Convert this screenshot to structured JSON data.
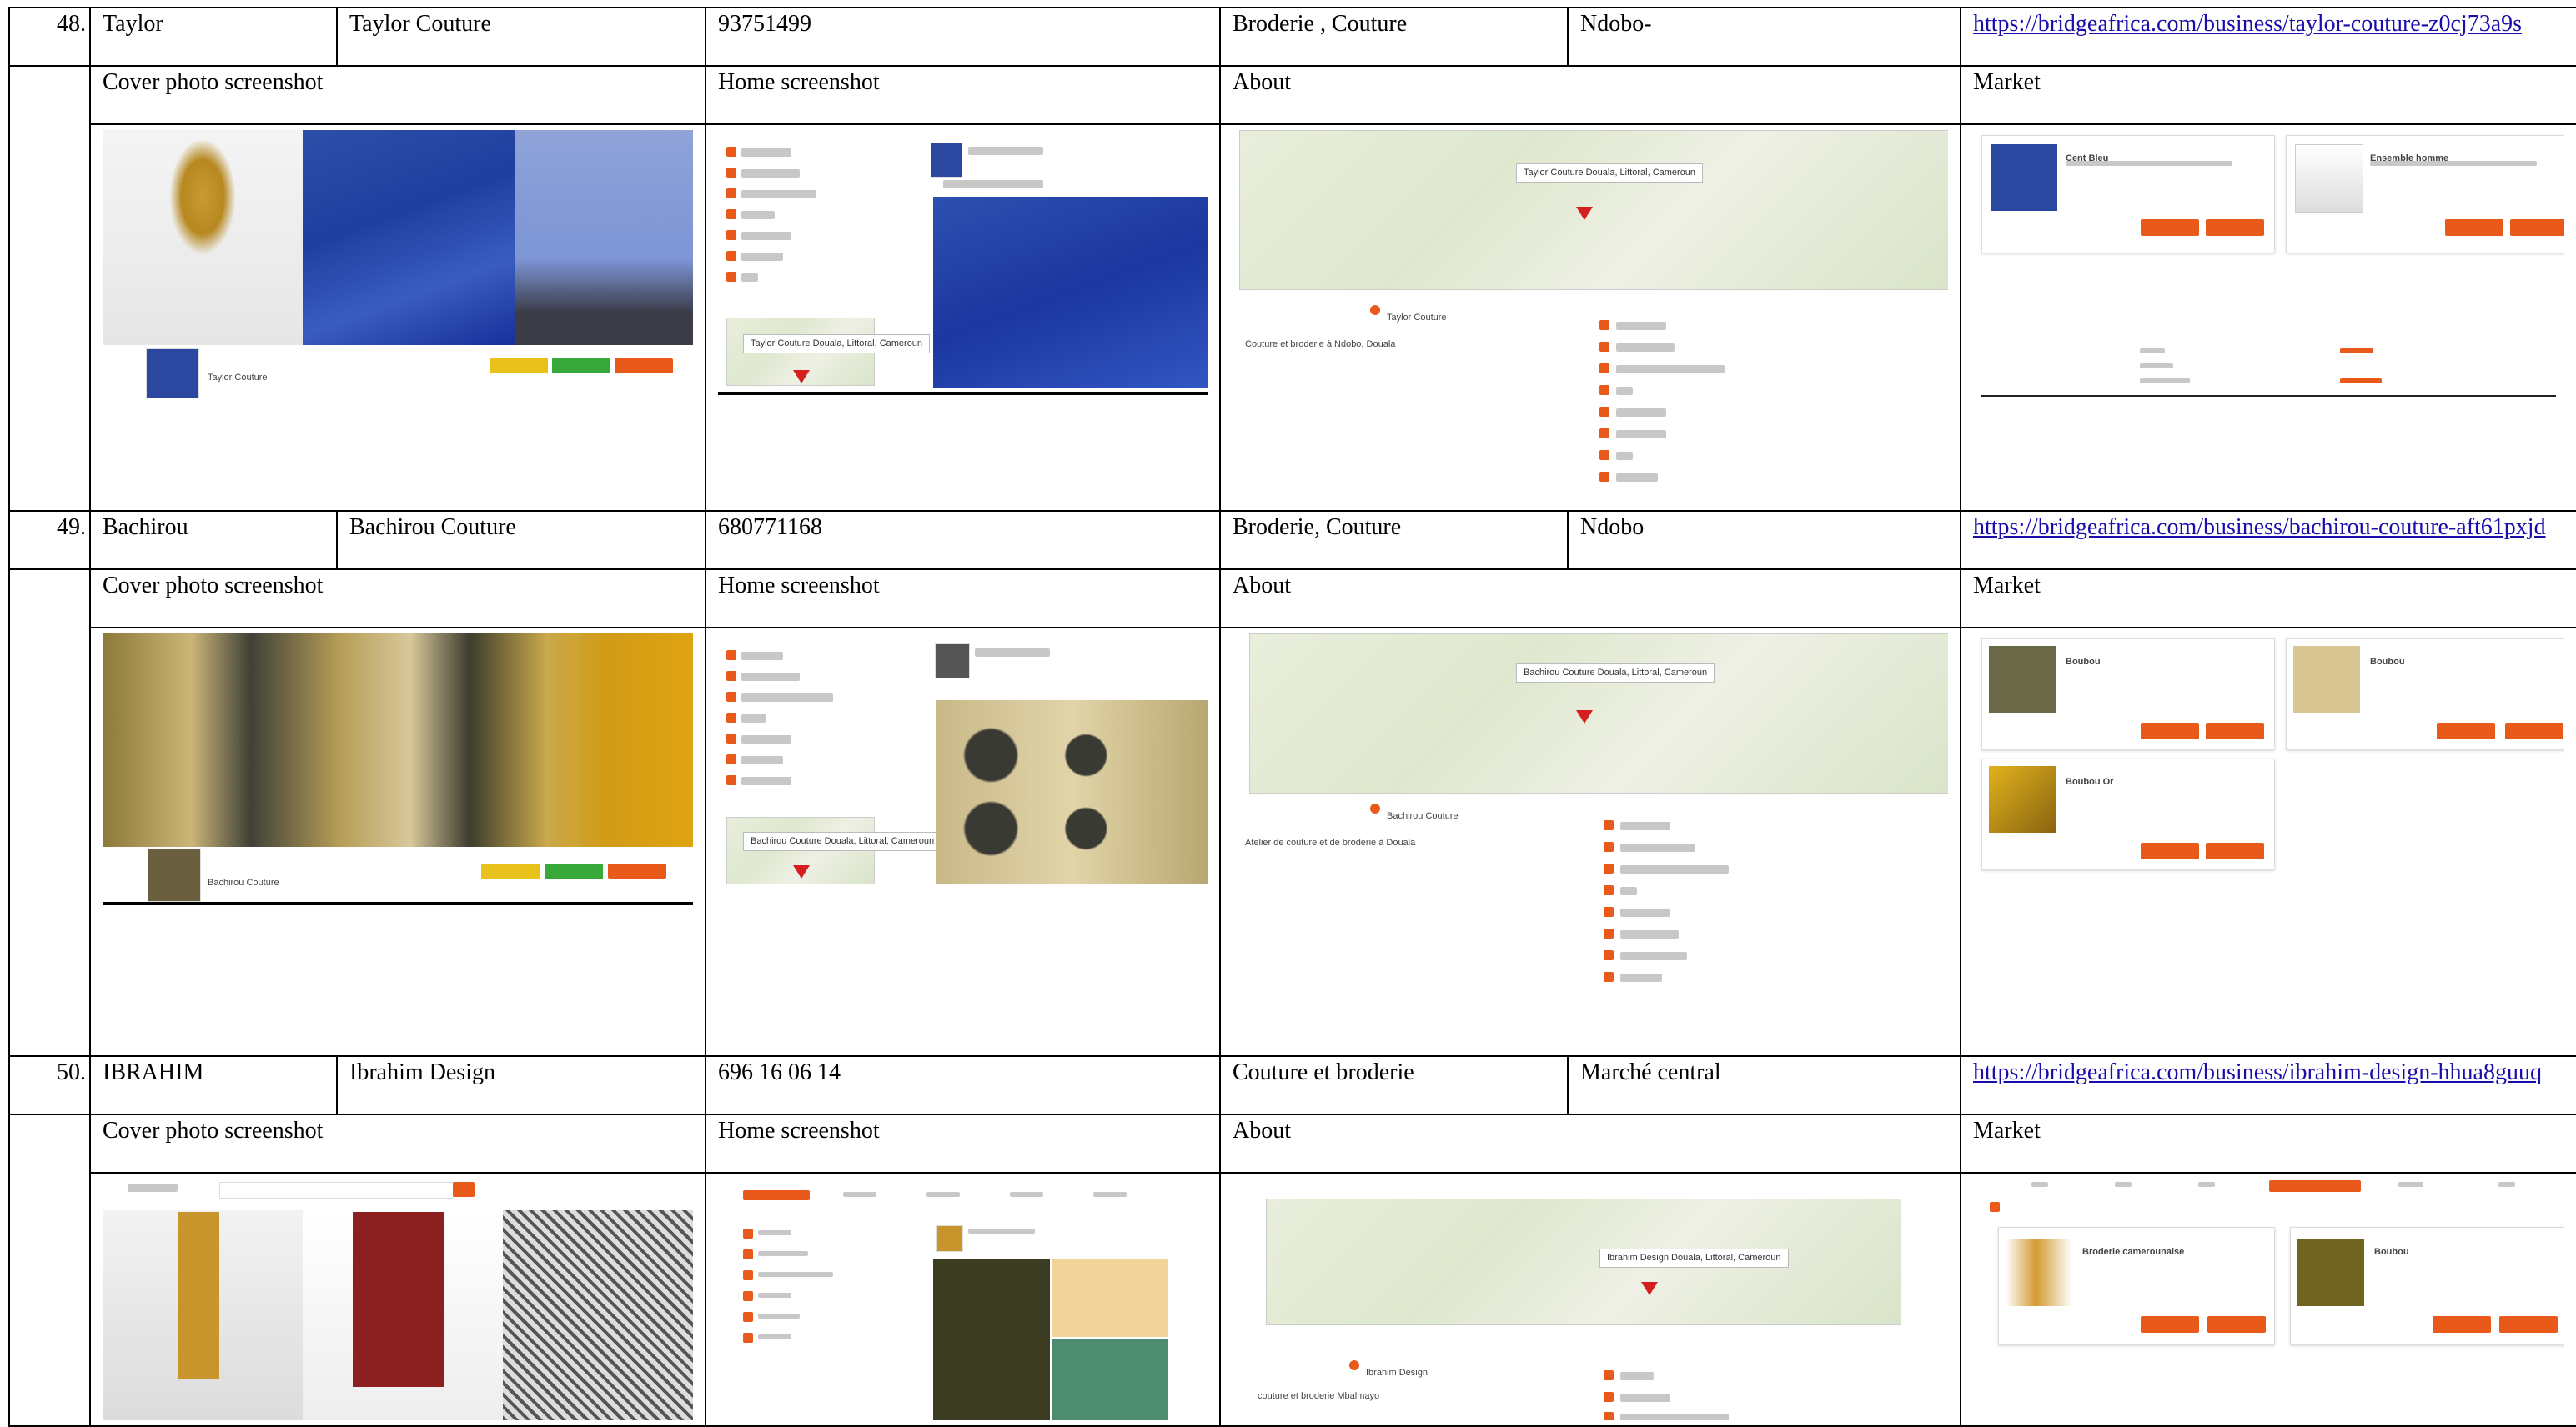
{
  "labels": {
    "cover": "Cover photo screenshot",
    "home": "Home screenshot",
    "about": "About",
    "market": "Market"
  },
  "rows": [
    {
      "num": "48.",
      "name": "Taylor",
      "business": "Taylor Couture",
      "phone": "93751499",
      "activity": "Broderie , Couture",
      "location": "Ndobo-",
      "url": "https://bridgeafrica.com/business/taylor-couture-z0cj73a9s",
      "about_text": "Couture et broderie à Ndobo, Douala",
      "map_callout": "Taylor Couture Douala, Littoral, Cameroun",
      "about_name": "Taylor Couture",
      "market_items": [
        "Cent Bleu",
        "Ensemble homme"
      ]
    },
    {
      "num": "49.",
      "name": "Bachirou",
      "business": "Bachirou Couture",
      "phone": "680771168",
      "activity": "Broderie, Couture",
      "location": "Ndobo",
      "url": "https://bridgeafrica.com/business/bachirou-couture-aft61pxjd",
      "about_text": "Atelier de couture et de broderie à Douala",
      "map_callout": "Bachirou Couture Douala, Littoral, Cameroun",
      "about_name": "Bachirou Couture",
      "market_items": [
        "Boubou",
        "Boubou",
        "Boubou Or"
      ]
    },
    {
      "num": "50.",
      "name": "IBRAHIM",
      "business": "Ibrahim Design",
      "phone": "696 16 06 14",
      "activity": "Couture et broderie",
      "location": "Marché central",
      "url": "https://bridgeafrica.com/business/ibrahim-design-hhua8guuq",
      "about_text": "couture et broderie Mbalmayo",
      "map_callout": "Ibrahim Design Douala, Littoral, Cameroun",
      "about_name": "Ibrahim Design",
      "market_items": [
        "Broderie camerounaise",
        "Boubou"
      ]
    }
  ],
  "colors": {
    "accent": "#e8591a",
    "link": "#1a0dab",
    "pin": "#d51f1f"
  }
}
